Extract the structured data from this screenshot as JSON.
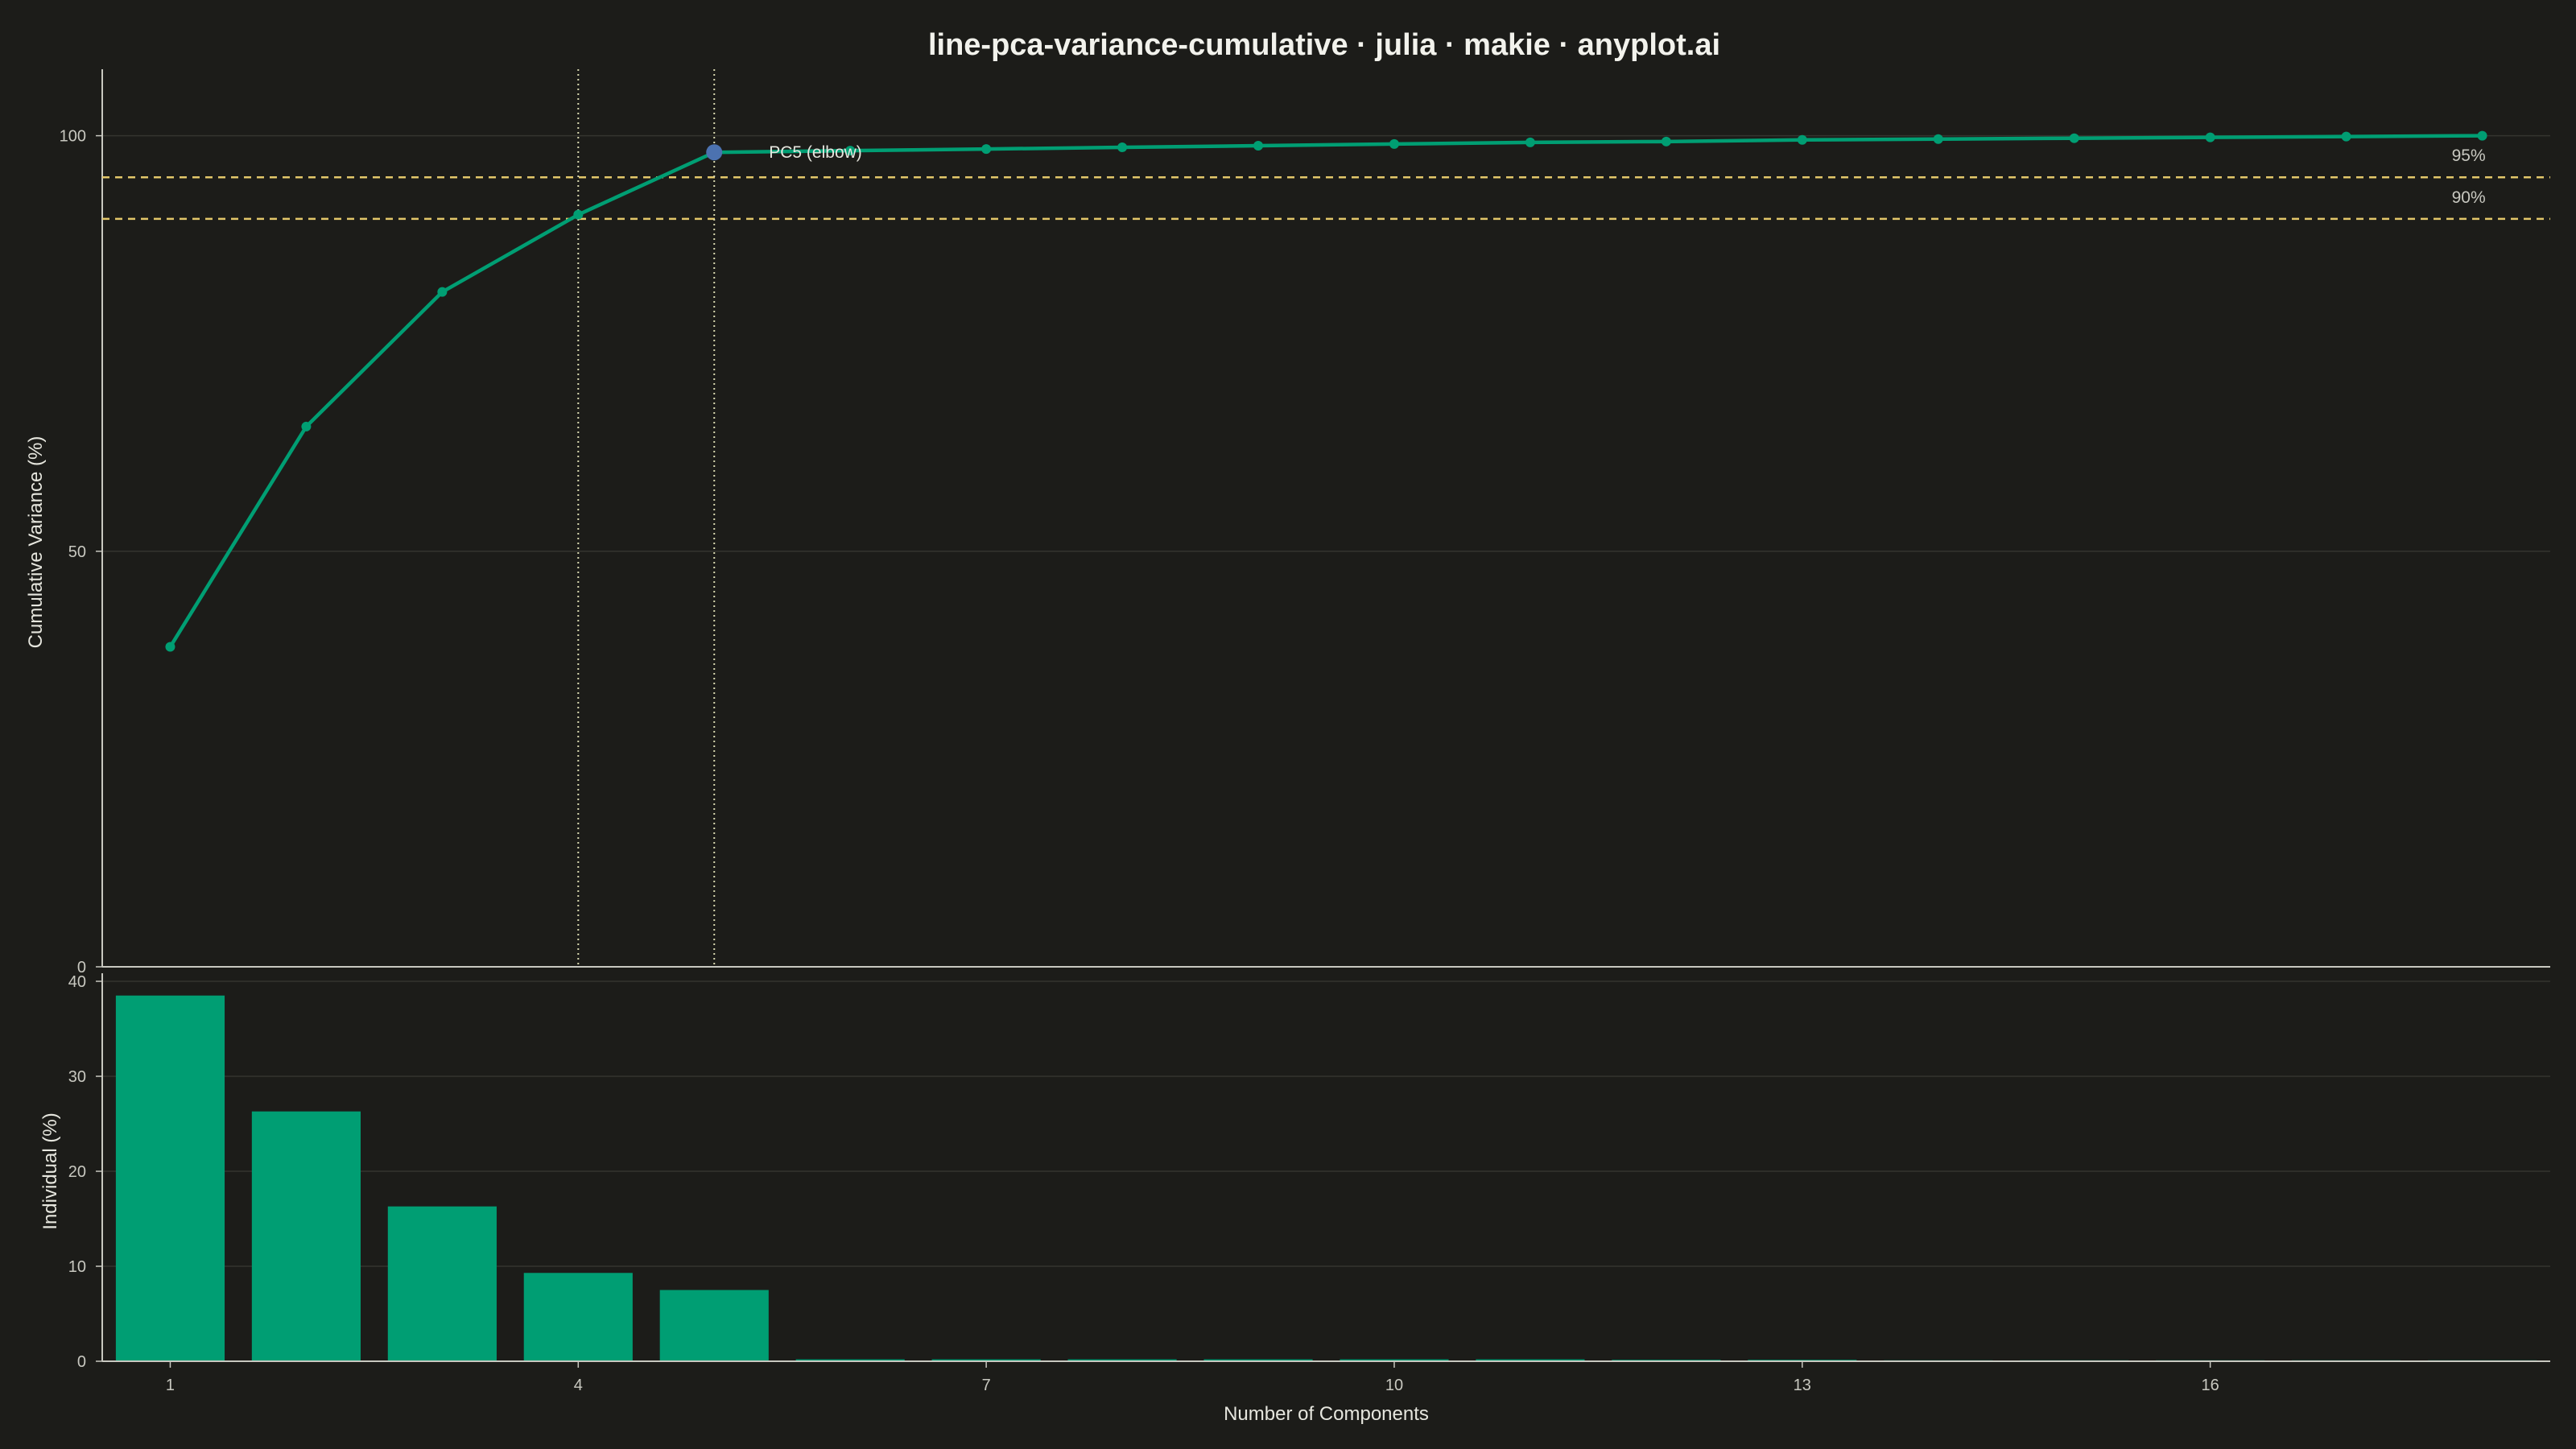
{
  "chart_data": {
    "title": "line-pca-variance-cumulative · julia · makie · anyplot.ai",
    "colors": {
      "background": "#1c1c19",
      "series": "#009e73",
      "highlight": "#4c72b0",
      "threshold": "#e3c76a",
      "grid": "#34342f",
      "axis": "#c8c8c0",
      "tick_text": "#c8c8c0"
    },
    "panels": [
      {
        "id": "cumulative",
        "type": "line",
        "ylabel": "Cumulative Variance (%)",
        "ylim": [
          0,
          108
        ],
        "yticks": [
          0,
          50,
          100
        ],
        "grid": true,
        "x": [
          1,
          2,
          3,
          4,
          5,
          6,
          7,
          8,
          9,
          10,
          11,
          12,
          13,
          14,
          15,
          16,
          17,
          18
        ],
        "values": [
          38.5,
          65,
          81.2,
          90.5,
          98.0,
          98.2,
          98.4,
          98.6,
          98.8,
          99.0,
          99.2,
          99.3,
          99.5,
          99.6,
          99.7,
          99.8,
          99.9,
          100
        ],
        "thresholds": [
          {
            "value": 95,
            "label": "95%"
          },
          {
            "value": 90,
            "label": "90%"
          }
        ],
        "vlines": [
          4,
          5
        ],
        "highlight": {
          "x": 5,
          "y": 98.0,
          "label": "PC5 (elbow)"
        }
      },
      {
        "id": "individual",
        "type": "bar",
        "ylabel": "Individual (%)",
        "xlabel": "Number of Components",
        "ylim": [
          0,
          40
        ],
        "yticks": [
          0,
          10,
          20,
          30,
          40
        ],
        "grid": true,
        "x": [
          1,
          2,
          3,
          4,
          5,
          6,
          7,
          8,
          9,
          10,
          11,
          12,
          13,
          14,
          15,
          16,
          17,
          18
        ],
        "values": [
          38.5,
          26.3,
          16.3,
          9.3,
          7.5,
          0.2,
          0.2,
          0.2,
          0.2,
          0.2,
          0.2,
          0.15,
          0.15,
          0.1,
          0.1,
          0.1,
          0.1,
          0.1
        ]
      }
    ],
    "xlim": [
      0.5,
      18.5
    ],
    "xticks": [
      1,
      4,
      7,
      10,
      13,
      16
    ]
  }
}
